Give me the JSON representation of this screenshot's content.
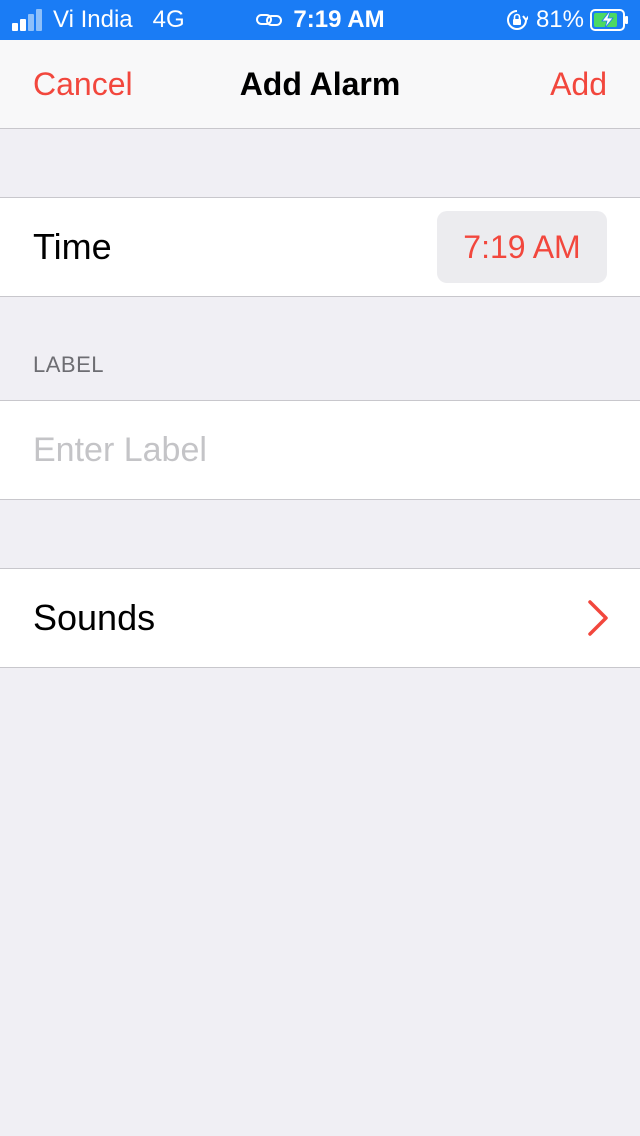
{
  "status_bar": {
    "carrier": "Vi India",
    "network": "4G",
    "time": "7:19 AM",
    "battery_percent": "81%",
    "icons": [
      "signal-icon",
      "link-icon",
      "orientation-lock-icon",
      "battery-charging-icon"
    ],
    "background_color": "#1a7cf5"
  },
  "nav": {
    "cancel_label": "Cancel",
    "title": "Add Alarm",
    "add_label": "Add"
  },
  "time_row": {
    "label": "Time",
    "value": "7:19 AM"
  },
  "label_section": {
    "header": "LABEL",
    "placeholder": "Enter Label",
    "value": ""
  },
  "sounds_row": {
    "label": "Sounds",
    "icon": "chevron-right-icon"
  },
  "colors": {
    "accent": "#f2473d",
    "background": "#f0eff4",
    "cell": "#ffffff",
    "separator": "#c8c7cc"
  }
}
